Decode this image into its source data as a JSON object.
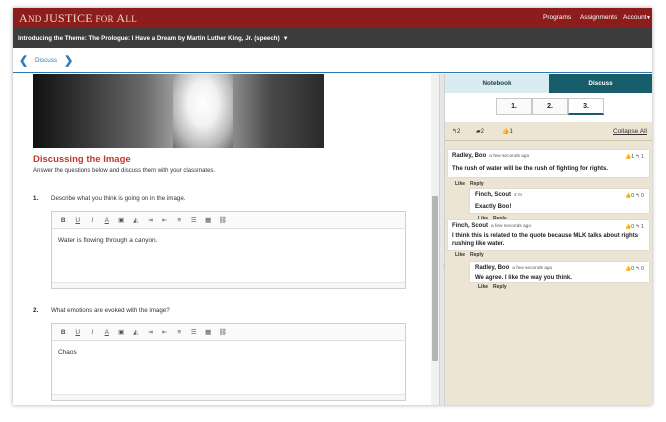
{
  "app": {
    "title_parts": [
      "A",
      "ND ",
      "JUSTICE",
      " FOR ",
      "A",
      "LL"
    ],
    "nav": [
      "Programs",
      "Assignments",
      "Account"
    ]
  },
  "lesson": {
    "title": "Introducing the Theme: The Prologue: I Have a Dream by Martin Luther King, Jr. (speech)"
  },
  "navbar": {
    "label": "Discuss"
  },
  "section": {
    "title": "Discussing the Image",
    "intro": "Answer the questions below and discuss them with your classmates."
  },
  "questions": [
    {
      "num": "1.",
      "text": "Describe what you think is going on in the image.",
      "answer": "Water is flowing through a canyon."
    },
    {
      "num": "2.",
      "text": "What emotions are evoked with the image?",
      "answer": "Chaos"
    }
  ],
  "toolbar_icons": [
    "bold-icon",
    "underline-icon",
    "italic-icon",
    "font-color-icon",
    "highlight-icon",
    "eraser-icon",
    "indent-icon",
    "outdent-icon",
    "align-left-icon",
    "list-icon",
    "table-icon",
    "link-icon"
  ],
  "toolbar_glyphs": [
    "B",
    "U",
    "I",
    "A",
    "▣",
    "◭",
    "⇥",
    "⇤",
    "≡",
    "☰",
    "▦",
    "⛓"
  ],
  "right": {
    "tabs": [
      "Notebook",
      "Discuss"
    ],
    "parts": [
      "1.",
      "2.",
      "3."
    ],
    "stats": {
      "replies": "2",
      "comments": "2",
      "likes": "1"
    },
    "collapse_label": "Collapse All",
    "comments": [
      {
        "author": "Radley, Boo",
        "time": "a few seconds ago",
        "body": "The rush of water will be the rush of fighting for rights.",
        "likes": "1",
        "replies": "1",
        "actions": [
          "Like",
          "Reply"
        ]
      },
      {
        "author": "Finch, Scout",
        "time": "2 m",
        "body": "Exactly Boo!",
        "likes": "0",
        "replies": "0",
        "actions": [
          "Like",
          "Reply"
        ]
      },
      {
        "author": "Finch, Scout",
        "time": "a few seconds ago",
        "body": "I think this is related to the quote because MLK talks about rights rushing like water.",
        "likes": "0",
        "replies": "1",
        "actions": [
          "Like",
          "Reply"
        ]
      },
      {
        "author": "Radley, Boo",
        "time": "a few seconds ago",
        "body": "We agree. I like the way you think.",
        "likes": "0",
        "replies": "0",
        "actions": [
          "Like",
          "Reply"
        ]
      }
    ]
  },
  "colors": {
    "brand": "#8b1d1d",
    "accent": "#2d7ab5",
    "teal": "#175d6b",
    "heading": "#c0392b"
  }
}
